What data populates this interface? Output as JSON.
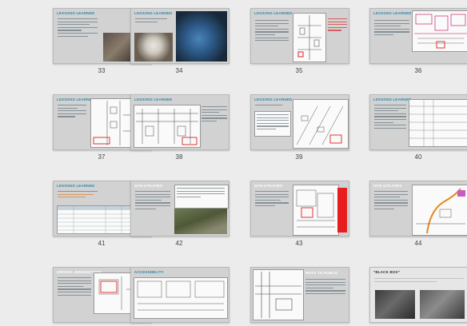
{
  "slides": [
    {
      "number": "33",
      "title": "LESSONS LEARNED"
    },
    {
      "number": "34",
      "title": "LESSONS LEARNED"
    },
    {
      "number": "35",
      "title": "LESSONS LEARNED"
    },
    {
      "number": "36",
      "title": "LESSONS LEARNED"
    },
    {
      "number": "37",
      "title": "LESSONS LEARNED"
    },
    {
      "number": "38",
      "title": "LESSONS LEARNED"
    },
    {
      "number": "39",
      "title": "LESSONS LEARNED"
    },
    {
      "number": "40",
      "title": "LESSONS LEARNED"
    },
    {
      "number": "41",
      "title": "LESSONS LEARNED"
    },
    {
      "number": "42",
      "title": "SITE UTILITIES"
    },
    {
      "number": "43",
      "title": "SITE UTILITIES"
    },
    {
      "number": "44",
      "title": "SITE UTILITIES"
    },
    {
      "number": "",
      "title": "GRAVES JURISDICTION"
    },
    {
      "number": "",
      "title": "ACCESSIBILITY"
    },
    {
      "number": "",
      "title": "WATS TO PUBLIC"
    },
    {
      "number": "",
      "title": "\"BLACK BOX\""
    }
  ]
}
